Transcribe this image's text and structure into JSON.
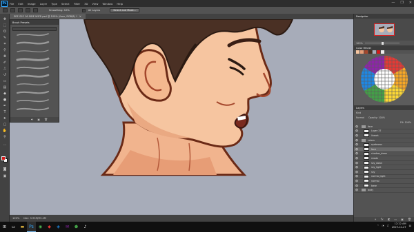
{
  "app": {
    "logo": "Ps"
  },
  "menu": [
    "File",
    "Edit",
    "Image",
    "Layer",
    "Type",
    "Select",
    "Filter",
    "3D",
    "View",
    "Window",
    "Help"
  ],
  "window_controls": {
    "minimize": "—",
    "maximize": "❐",
    "close": "✕"
  },
  "options": {
    "smoothing_label": "Smoothing: 10%",
    "all_layers_label": "All Layers",
    "select_mask": "Select and Mask..."
  },
  "document": {
    "tab_title": "EEE S1E 16 SIDE WIFE.psd @ 100% (face, RGB/8) *"
  },
  "brush_panel": {
    "title": "Brush Presets"
  },
  "status": {
    "zoom": "100%",
    "doc_size": "Doc: 5.93M/95.2M"
  },
  "panels": {
    "navigator_title": "Navigator",
    "zoom_value": "100%",
    "color_title": "Color Wheel",
    "layers_title": "Layers",
    "kind_label": "Kind",
    "blend_mode": "Normal",
    "opacity": "Opacity: 100%",
    "fill": "Fill: 100%",
    "layers": [
      {
        "name": "face",
        "type": "folder",
        "active": false
      },
      {
        "name": "Layer 37",
        "type": "layer",
        "active": false
      },
      {
        "name": "lineart",
        "type": "layer",
        "active": false
      },
      {
        "name": "colors",
        "type": "folder",
        "active": false
      },
      {
        "name": "eyebrows",
        "type": "layer",
        "active": false
      },
      {
        "name": "face",
        "type": "layer",
        "active": true
      },
      {
        "name": "shadow_down",
        "type": "layer",
        "active": false
      },
      {
        "name": "shade",
        "type": "layer",
        "active": false
      },
      {
        "name": "sky_down",
        "type": "layer",
        "active": false
      },
      {
        "name": "sky_light",
        "type": "layer",
        "active": false
      },
      {
        "name": "sky",
        "type": "layer",
        "active": false
      },
      {
        "name": "normal_light",
        "type": "layer",
        "active": false
      },
      {
        "name": "normal",
        "type": "layer",
        "active": false
      },
      {
        "name": "base",
        "type": "layer",
        "active": false
      },
      {
        "name": "body",
        "type": "folder",
        "active": false
      }
    ]
  },
  "taskbar": {
    "time": "12:22 AM",
    "date": "2019-12-27"
  },
  "colors": {
    "foreground": "#d41a1a",
    "background": "#ffffff"
  }
}
